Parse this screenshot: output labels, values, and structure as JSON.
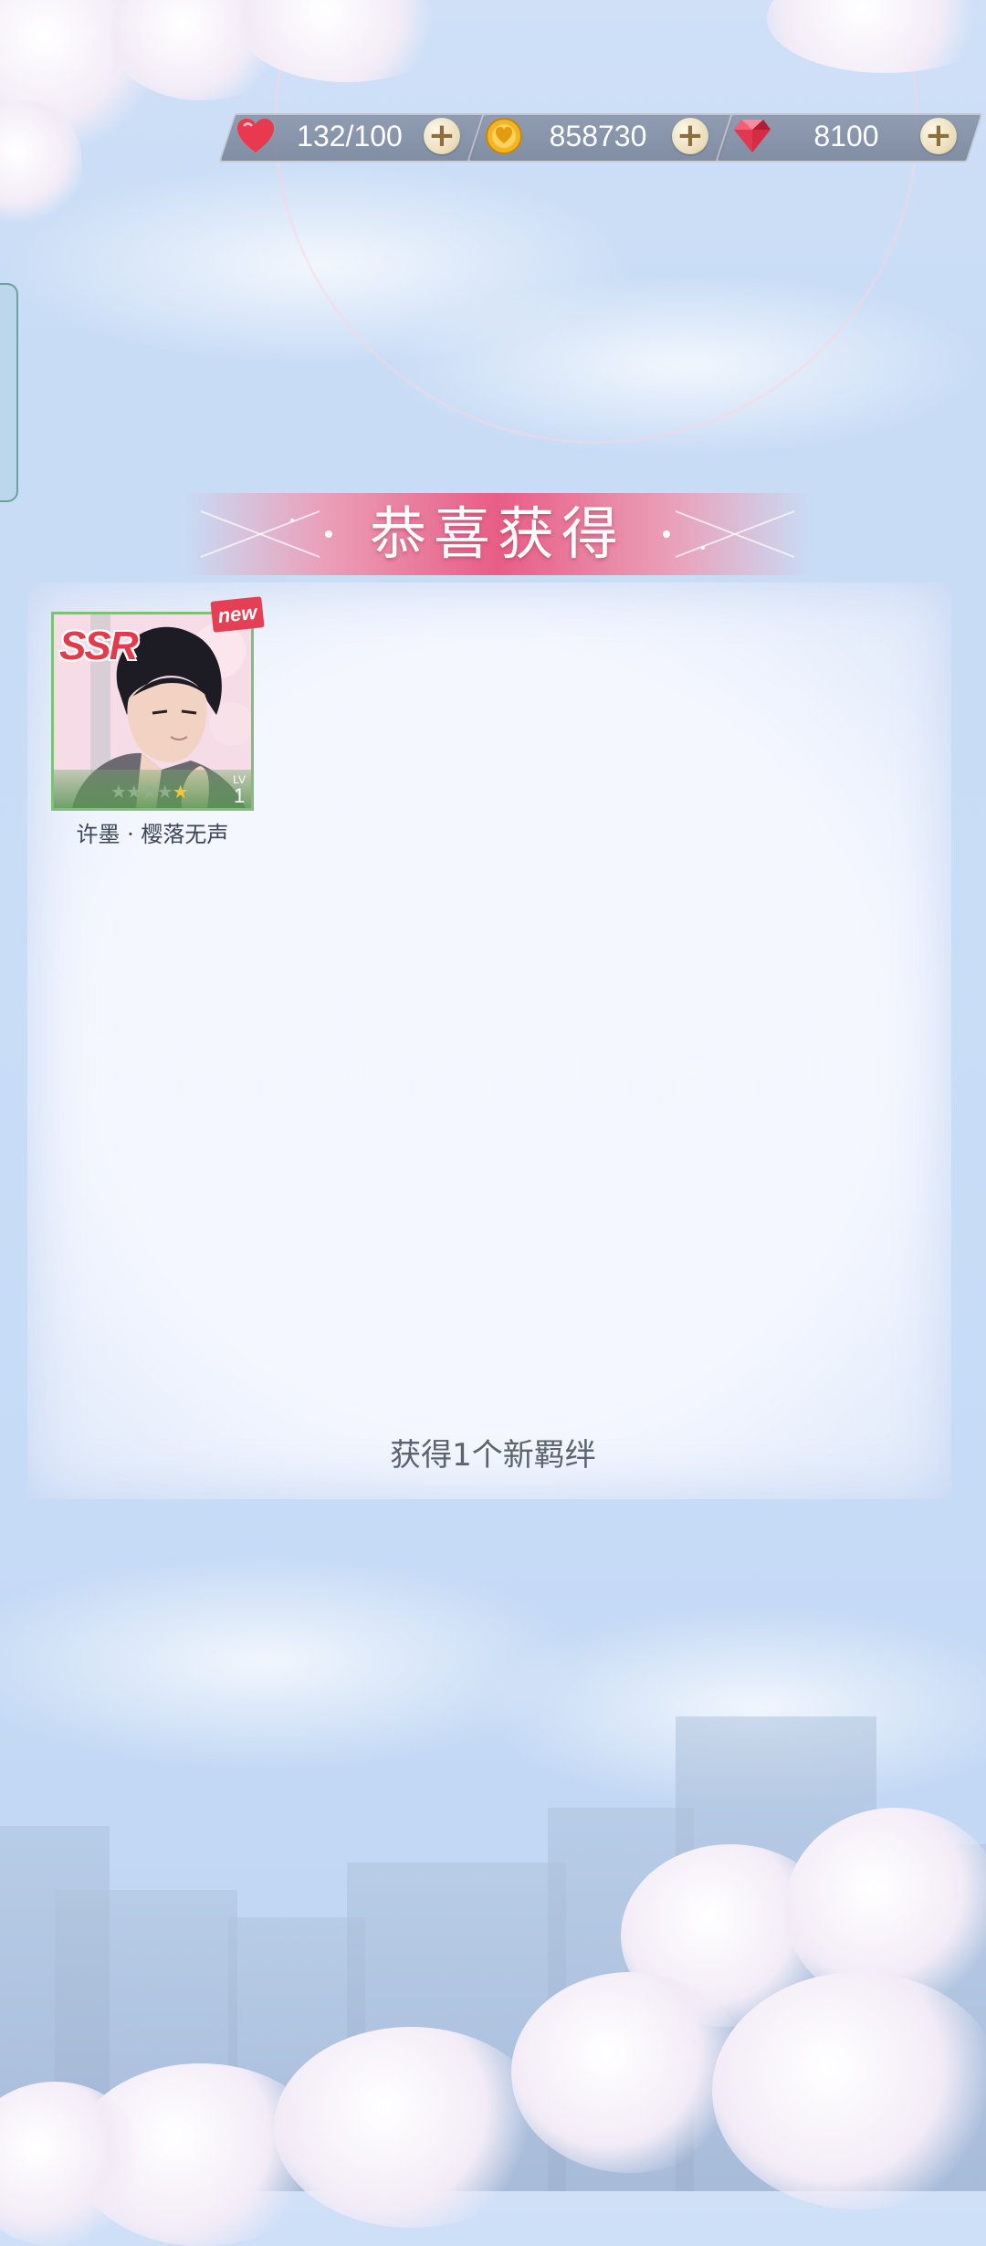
{
  "resources": {
    "stamina": {
      "icon": "heart-icon",
      "value": "132/100"
    },
    "coins": {
      "icon": "gold-coin-icon",
      "value": "858730"
    },
    "diamonds": {
      "icon": "ruby-gem-icon",
      "value": "8100"
    },
    "plus_label": "+"
  },
  "banner": {
    "title": "恭喜获得"
  },
  "reward_card": {
    "rarity": "SSR",
    "badge": "new",
    "stars_total": 5,
    "stars_filled": 1,
    "stars_text_empty": "★★★★",
    "stars_text_filled": "★",
    "level_label": "LV",
    "level_value": "1",
    "name": "许墨 · 樱落无声"
  },
  "summary": "获得1个新羁绊",
  "colors": {
    "banner": "#e85d86",
    "card_border": "#7fbf7a",
    "rarity": "#e23b4c",
    "badge": "#e53f56"
  }
}
